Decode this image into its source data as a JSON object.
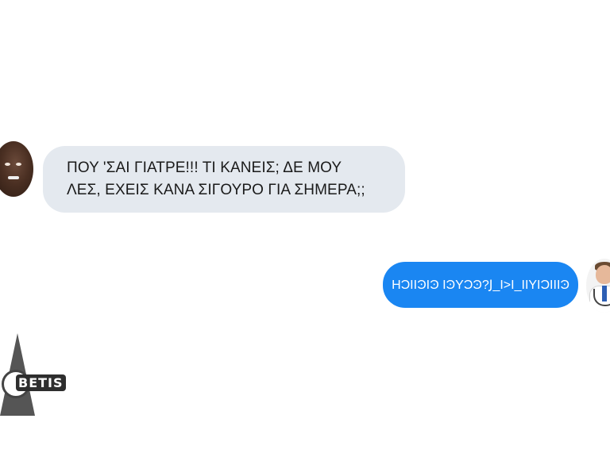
{
  "conversation": {
    "incoming": {
      "lines": [
        "ΠΟΥ 'ΣΑΙ ΓΙΑΤΡΕ!!! ΤΙ ΚΑΝΕΙΣ; ΔΕ ΜΟΥ",
        "ΛΕΣ, ΕΧΕΙΣ ΚΑΝΑ ΣΙΓΟΥΡΟ ΓΙΑ ΣΗΜΕΡΑ;;"
      ],
      "bubble_color": "#e4e9ef",
      "avatar_icon": "man-avatar-icon"
    },
    "outgoing": {
      "text": "ΗϽΙΙϿΙϿ ΙϿΥϽϿ?Ϳ_Ι>Ι_ΙΙΥΙϽΙΙΙϿ",
      "bubble_color": "#1a86f2",
      "avatar_icon": "doctor-avatar-icon"
    }
  },
  "watermark": {
    "text": "BETIS",
    "icon": "betis-logo-icon"
  }
}
